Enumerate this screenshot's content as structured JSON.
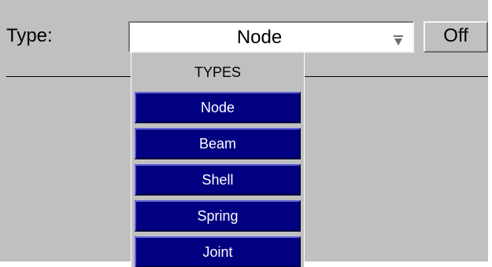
{
  "type_row": {
    "label": "Type:",
    "selected_value": "Node",
    "arrow_icon": "dropdown-arrow-icon",
    "off_button_label": "Off"
  },
  "dropdown": {
    "header": "TYPES",
    "items": [
      {
        "label": "Node"
      },
      {
        "label": "Beam"
      },
      {
        "label": "Shell"
      },
      {
        "label": "Spring"
      },
      {
        "label": "Joint"
      }
    ]
  },
  "colors": {
    "panel_bg": "#c0c0c0",
    "item_bg": "#000080",
    "item_text": "#ffffff"
  }
}
